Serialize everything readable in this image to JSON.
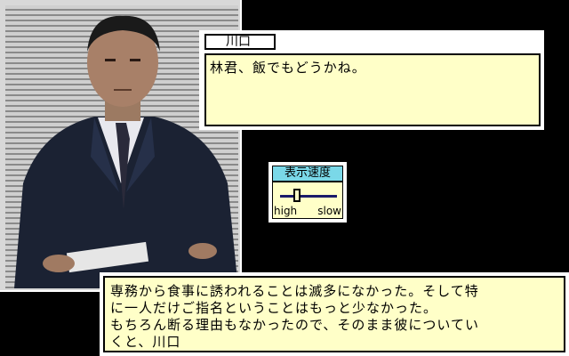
{
  "scene": {
    "portrait_subject": "man-in-suit-portrait"
  },
  "dialogue": {
    "speaker_name": "川口",
    "speaker_line": "林君、飯でもどうかね。"
  },
  "speed_control": {
    "title": "表示速度",
    "low_label": "high",
    "high_label": "slow",
    "level": 0.3
  },
  "narration": {
    "lines": [
      "専務から食事に誘われることは滅多になかった。そして特",
      "に一人だけご指名ということはもっと少なかった。",
      "もちろん断る理由もなかったので、そのまま彼についてい",
      "くと、川口"
    ]
  },
  "colors": {
    "text_bg": "#ffffc8",
    "title_bg": "#7ad8e8",
    "track": "#1a1a6a"
  }
}
